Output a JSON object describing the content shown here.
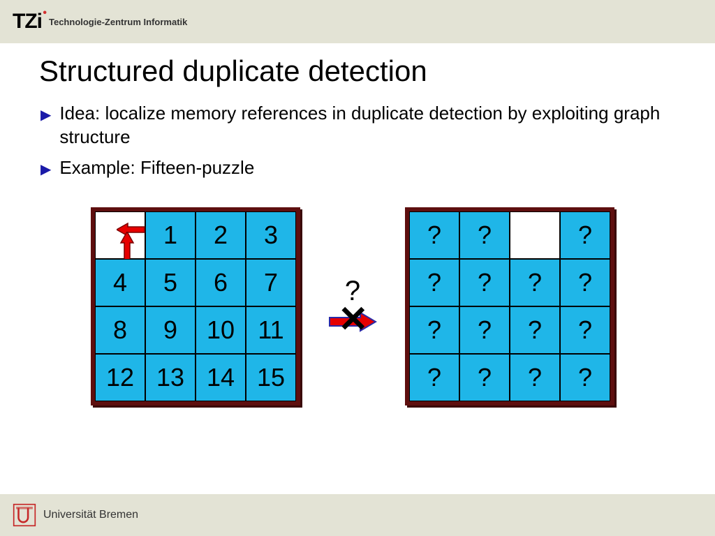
{
  "header": {
    "logo_text": "TZi",
    "logo_subtitle": "Technologie-Zentrum Informatik"
  },
  "title": "Structured duplicate detection",
  "bullets": [
    "Idea: localize memory references in duplicate detection by exploiting graph structure",
    "Example: Fifteen-puzzle"
  ],
  "puzzle_left": [
    [
      "",
      "1",
      "2",
      "3"
    ],
    [
      "4",
      "5",
      "6",
      "7"
    ],
    [
      "8",
      "9",
      "10",
      "11"
    ],
    [
      "12",
      "13",
      "14",
      "15"
    ]
  ],
  "puzzle_right": [
    [
      "?",
      "?",
      "",
      "?"
    ],
    [
      "?",
      "?",
      "?",
      "?"
    ],
    [
      "?",
      "?",
      "?",
      "?"
    ],
    [
      "?",
      "?",
      "?",
      "?"
    ]
  ],
  "transition_label": "?",
  "footer": {
    "university": "Universität Bremen"
  }
}
